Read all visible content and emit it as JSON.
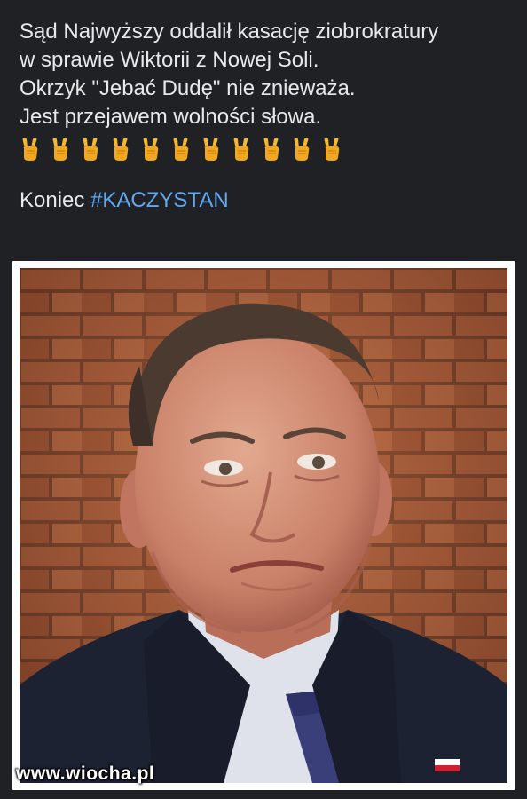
{
  "post": {
    "lines": [
      "Sąd Najwyższy oddalił kasację ziobrokratury",
      "w sprawie Wiktorii z Nowej Soli.",
      "Okrzyk \"Jebać Dudę\" nie znieważa.",
      "Jest przejawem wolności słowa."
    ],
    "emoji": {
      "icon": "victory-hand-icon",
      "count": 11
    },
    "footer_prefix": "Koniec ",
    "hashtag": "#KACZYSTAN"
  },
  "image": {
    "subject": "photo-portrait",
    "watermark": "www.wiocha.pl"
  },
  "colors": {
    "background": "#202124",
    "text": "#e8e8e8",
    "hashtag": "#5fa9f2"
  }
}
